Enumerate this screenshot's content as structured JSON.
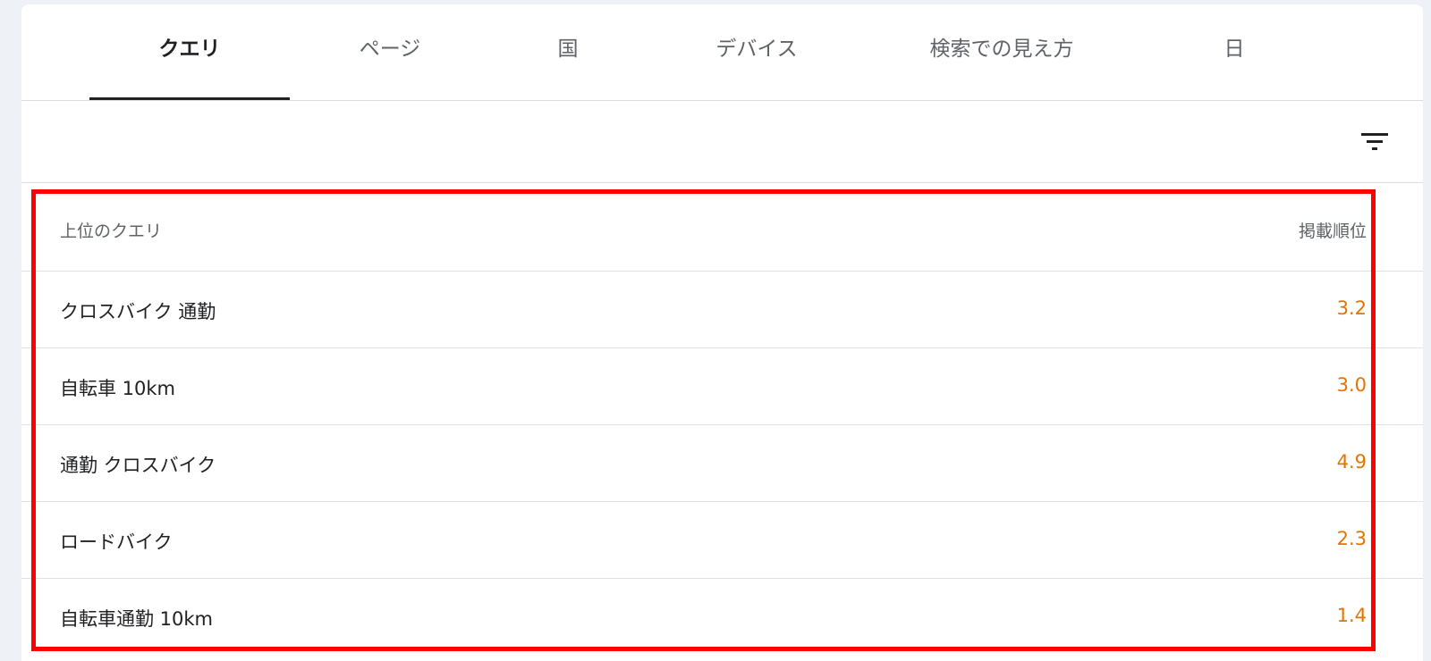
{
  "tabs": [
    {
      "label": "クエリ",
      "active": true
    },
    {
      "label": "ページ",
      "active": false
    },
    {
      "label": "国",
      "active": false
    },
    {
      "label": "デバイス",
      "active": false
    },
    {
      "label": "検索での見え方",
      "active": false
    },
    {
      "label": "日",
      "active": false
    }
  ],
  "toolbar": {
    "filter_icon": "filter-icon"
  },
  "table": {
    "headers": {
      "query": "上位のクエリ",
      "position": "掲載順位"
    },
    "rows": [
      {
        "query": "クロスバイク 通勤",
        "position": "3.2"
      },
      {
        "query": "自転車 10km",
        "position": "3.0"
      },
      {
        "query": "通勤 クロスバイク",
        "position": "4.9"
      },
      {
        "query": "ロードバイク",
        "position": "2.3"
      },
      {
        "query": "自転車通勤 10km",
        "position": "1.4"
      }
    ]
  },
  "colors": {
    "value": "#e37400",
    "highlight": "#ff0000",
    "active_tab": "#202124"
  }
}
